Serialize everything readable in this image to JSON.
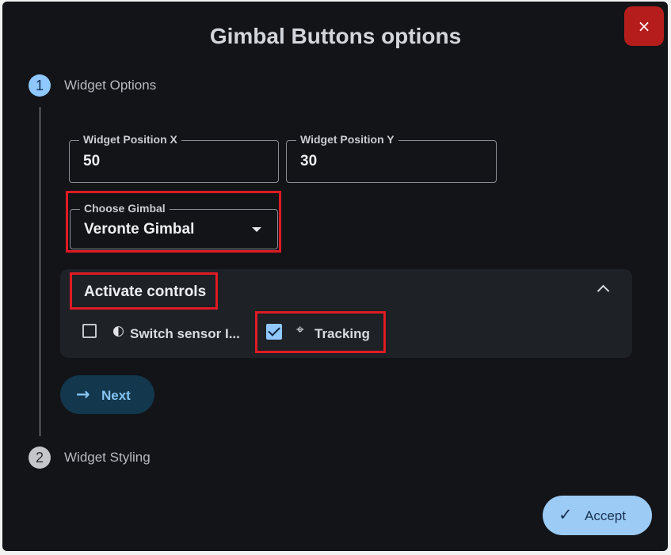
{
  "dialog": {
    "title": "Gimbal Buttons options",
    "close_icon": "×"
  },
  "steps": [
    {
      "number": "1",
      "label": "Widget Options",
      "state": "active"
    },
    {
      "number": "2",
      "label": "Widget Styling",
      "state": "inactive"
    }
  ],
  "fields": {
    "position_x": {
      "label": "Widget Position X",
      "value": "50"
    },
    "position_y": {
      "label": "Widget Position Y",
      "value": "30"
    },
    "gimbal": {
      "label": "Choose Gimbal",
      "value": "Veronte Gimbal"
    }
  },
  "activate_controls": {
    "title": "Activate controls",
    "items": [
      {
        "icon": "◐",
        "icon_name": "contrast-icon",
        "label": "Switch sensor I...",
        "checked": false
      },
      {
        "icon": "⌖",
        "icon_name": "crosshair-icon",
        "label": "Tracking",
        "checked": true
      }
    ]
  },
  "buttons": {
    "next_icon": "→",
    "next_label": "Next",
    "accept_icon": "✓",
    "accept_label": "Accept"
  },
  "colors": {
    "background": "#121417",
    "accent": "#90c8ff",
    "close": "#b51d1d",
    "highlight": "#e01b24"
  }
}
